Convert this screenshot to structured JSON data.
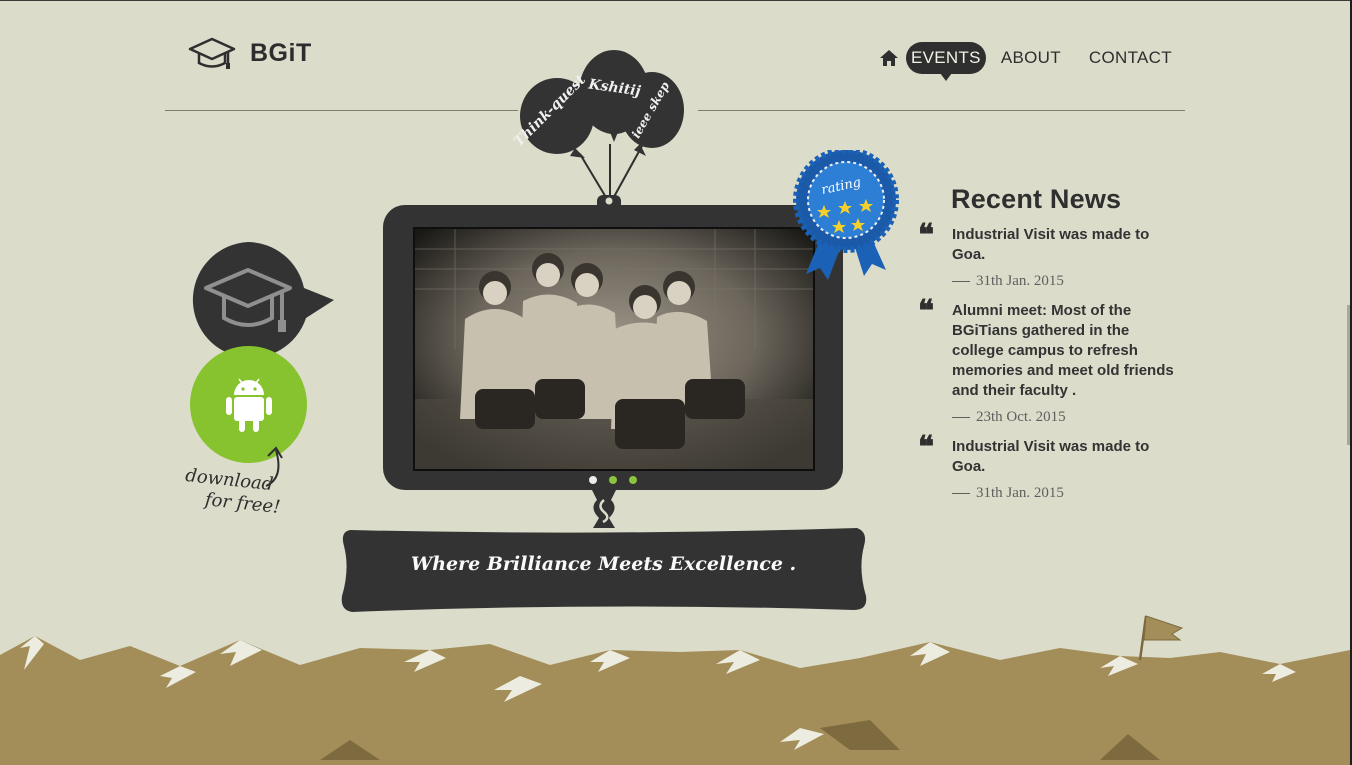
{
  "header": {
    "logo_text": "BGiT",
    "nav": [
      {
        "label": "EVENTS",
        "active": true
      },
      {
        "label": "ABOUT",
        "active": false
      },
      {
        "label": "CONTACT",
        "active": false
      }
    ]
  },
  "balloons": [
    "Think-quest",
    "Kshitij",
    "ieee skep"
  ],
  "slider": {
    "active_index": 0,
    "slide_count": 3,
    "caption": "Where Brilliance Meets Excellence ."
  },
  "rating_badge": {
    "label": "rating",
    "stars": 5
  },
  "app_promo": {
    "line1": "download",
    "line2": "for free!"
  },
  "news": {
    "heading": "Recent News",
    "items": [
      {
        "title": "Industrial Visit was made to Goa.",
        "date": "31th Jan. 2015"
      },
      {
        "title": "Alumni meet: Most of the BGiTians gathered in the college campus to refresh memories and meet old friends and their faculty .",
        "date": "23th Oct. 2015"
      },
      {
        "title": "Industrial Visit was made to Goa.",
        "date": "31th Jan. 2015"
      }
    ]
  },
  "colors": {
    "background": "#dcdccb",
    "dark": "#333333",
    "android_green": "#87c22f",
    "mountain": "#a38d58",
    "ribbon_blue": "#1b62b6"
  }
}
